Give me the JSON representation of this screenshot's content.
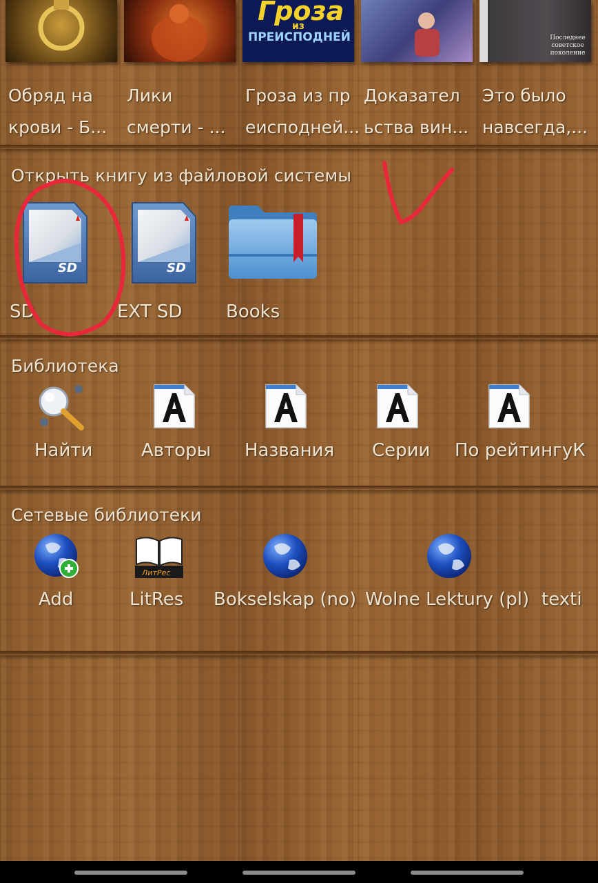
{
  "recent_books": [
    {
      "title": "Обряд на крови - Б..."
    },
    {
      "title": "Лики смерти - ..."
    },
    {
      "title": "Гроза из пр еисподней...",
      "cover_text_top": "Гроза",
      "cover_text_mid": "из",
      "cover_text_bottom": "Преисподней"
    },
    {
      "title": "Доказател ьства вин..."
    },
    {
      "title": "Это было навсегда,...",
      "cover_text": "Последнее советское поколение"
    }
  ],
  "filesystem": {
    "title": "Открыть книгу из файловой системы",
    "items": [
      {
        "label": "SD",
        "icon": "sd-card-icon",
        "card_text": "SD"
      },
      {
        "label": "EXT SD",
        "icon": "sd-card-icon",
        "card_text": "SD"
      },
      {
        "label": "Books",
        "icon": "folder-bookmark-icon"
      }
    ]
  },
  "library": {
    "title": "Библиотека",
    "items": [
      {
        "label": "Найти",
        "icon": "search-icon"
      },
      {
        "label": "Авторы",
        "icon": "font-file-icon"
      },
      {
        "label": "Названия",
        "icon": "font-file-icon"
      },
      {
        "label": "Серии",
        "icon": "font-file-icon"
      },
      {
        "label": "По рейтингуК ",
        "icon": "font-file-icon"
      }
    ]
  },
  "network": {
    "title": "Сетевые библиотеки",
    "items": [
      {
        "label": "Add",
        "icon": "globe-add-icon"
      },
      {
        "label": "LitRes",
        "icon": "litres-book-icon",
        "logo_text": "ЛитРес"
      },
      {
        "label": "Bokselskap (no)",
        "icon": "globe-icon"
      },
      {
        "label": "Wolne Lektury (pl)",
        "icon": "globe-icon"
      },
      {
        "label": "texti",
        "icon": "globe-icon"
      }
    ]
  },
  "colors": {
    "annotation": "#e8283a",
    "wood": "#8a5a2e",
    "label_text": "#f0e4d1"
  }
}
